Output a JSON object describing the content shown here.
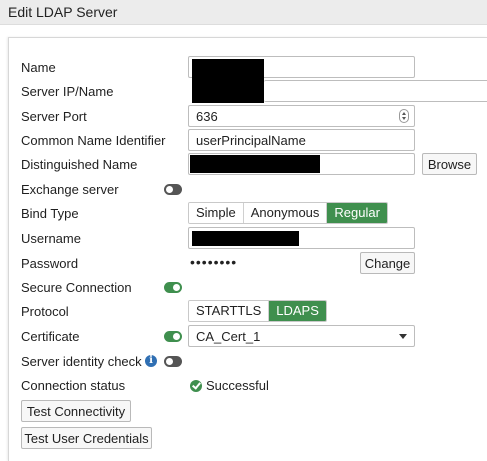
{
  "window": {
    "title": "Edit LDAP Server"
  },
  "form": {
    "name": {
      "label": "Name",
      "value": ""
    },
    "server_ip": {
      "label": "Server IP/Name",
      "value": ""
    },
    "server_port": {
      "label": "Server Port",
      "value": "636"
    },
    "cn_identifier": {
      "label": "Common Name Identifier",
      "value": "userPrincipalName"
    },
    "dn": {
      "label": "Distinguished Name",
      "value": "",
      "browse_label": "Browse"
    },
    "exchange": {
      "label": "Exchange server",
      "enabled": false
    },
    "bind_type": {
      "label": "Bind Type",
      "options": [
        "Simple",
        "Anonymous",
        "Regular"
      ],
      "selected": "Regular"
    },
    "username": {
      "label": "Username",
      "value": ""
    },
    "password": {
      "label": "Password",
      "value": "••••••••",
      "change_label": "Change"
    },
    "secure_connection": {
      "label": "Secure Connection",
      "enabled": true
    },
    "protocol": {
      "label": "Protocol",
      "options": [
        "STARTTLS",
        "LDAPS"
      ],
      "selected": "LDAPS"
    },
    "certificate": {
      "label": "Certificate",
      "enabled": true,
      "value": "CA_Cert_1"
    },
    "server_identity_check": {
      "label": "Server identity check",
      "enabled": false
    },
    "connection_status": {
      "label": "Connection status",
      "value": "Successful"
    }
  },
  "actions": {
    "test_connectivity": "Test Connectivity",
    "test_user_credentials": "Test User Credentials"
  },
  "colors": {
    "accent_green": "#3f8f4e",
    "toggle_off": "#555555",
    "info_blue": "#2f6fb3"
  }
}
